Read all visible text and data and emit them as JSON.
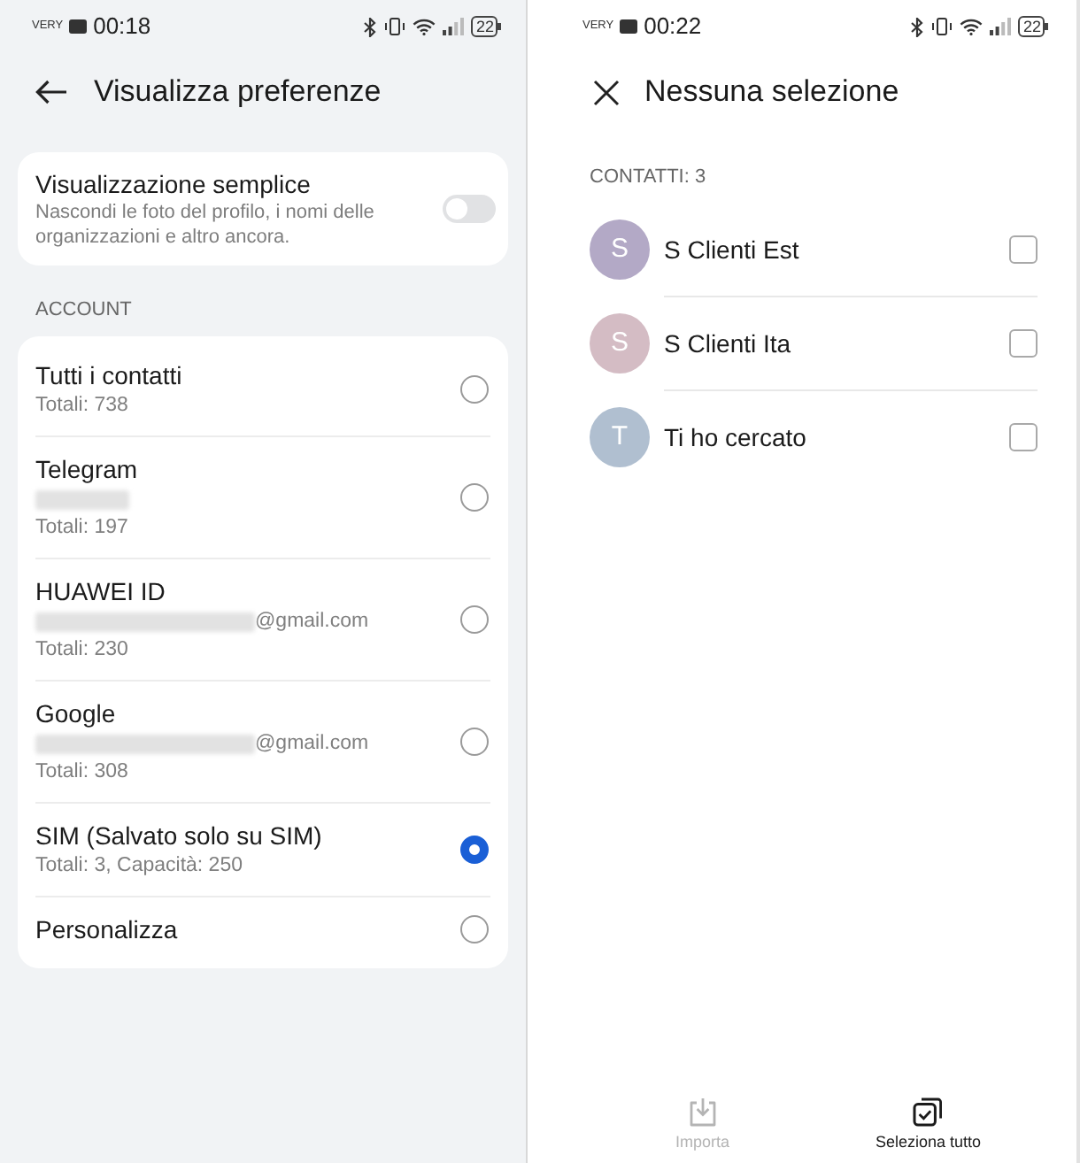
{
  "preferences_screen": {
    "status_bar": {
      "carrier": "VERY",
      "time": "00:18",
      "battery": "22"
    },
    "title": "Visualizza preferenze",
    "simple_view": {
      "title": "Visualizzazione semplice",
      "description": "Nascondi le foto del profilo, i nomi delle organizzazioni e altro ancora.",
      "on": false
    },
    "account_section": {
      "heading": "ACCOUNT",
      "accounts": [
        {
          "name": "Tutti i contatti",
          "redacted": false,
          "total": "Totali: 738",
          "selected": false
        },
        {
          "name": "Telegram",
          "redacted": true,
          "total": "Totali: 197",
          "selected": false
        },
        {
          "name": "HUAWEI ID",
          "redacted": true,
          "email_domain": "@gmail.com",
          "total": "Totali: 230",
          "selected": false
        },
        {
          "name": "Google",
          "redacted": true,
          "email_domain": "@gmail.com",
          "total": "Totali: 308",
          "selected": false
        },
        {
          "name": "SIM (Salvato solo su SIM)",
          "redacted": false,
          "total": "Totali: 3, Capacità: 250",
          "selected": true
        },
        {
          "name": "Personalizza",
          "redacted": false,
          "selected": false
        }
      ]
    }
  },
  "selection_screen": {
    "status_bar": {
      "carrier": "VERY",
      "time": "00:22",
      "battery": "22"
    },
    "title": "Nessuna selezione",
    "count_label": "CONTATTI: 3",
    "contacts": [
      {
        "initial": "S",
        "name": "S Clienti Est",
        "color": "#b3a9c6",
        "checked": false
      },
      {
        "initial": "S",
        "name": "S Clienti Ita",
        "color": "#d4bcc4",
        "checked": false
      },
      {
        "initial": "T",
        "name": "Ti ho cercato",
        "color": "#b0bfd0",
        "checked": false
      }
    ],
    "actions": [
      {
        "kind": "import",
        "label": "Importa",
        "disabled": true
      },
      {
        "kind": "select_all",
        "label": "Seleziona tutto",
        "disabled": false
      }
    ]
  }
}
